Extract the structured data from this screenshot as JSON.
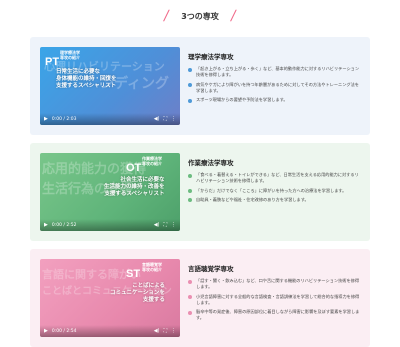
{
  "section": {
    "title": "3つの専攻",
    "accent_color": "#f06a8a"
  },
  "courses": [
    {
      "key": "pt",
      "abbr": "PT",
      "badge_sub": [
        "理学療法学",
        "専攻の紹介"
      ],
      "bg_text": [
        "心理リハビリテーション",
        "ンディング"
      ],
      "overlay_lines": [
        "日常生活に必要な",
        "身体機能の維持・回復を",
        "支援するスペシャリスト"
      ],
      "time": "0:00 / 2:03",
      "title": "理学療法学専攻",
      "bullets": [
        "「起き上がる・立ち上がる・歩く」など、基本的動作能力に対するリハビリテーション技術を修得します。",
        "病気やケガにより障がいを持つ年齢層があるために対してその方法やトレーニング法を学習します。",
        "スポーツ現場からの要望や予防法を学習します。"
      ]
    },
    {
      "key": "ot",
      "abbr": "OT",
      "badge_sub": [
        "作業療法学",
        "専攻の紹介"
      ],
      "bg_text": [
        "応用的能力の獲得",
        "生活行為の支援"
      ],
      "overlay_lines": [
        "社会生活に必要な",
        "生活能力の維持・改善を",
        "支援するスペシャリスト"
      ],
      "time": "0:00 / 2:52",
      "title": "作業療法学専攻",
      "bullets": [
        "「食べる・着替える・トイレができる」など、日常生活を支える応用的能力に対するリハビリテーション技術を修得します。",
        "「からだ」だけでなく「こころ」に障がいを持った方への治療法を学習します。",
        "自助具・義肢などや福祉・住宅改修のあり方を学習します。"
      ]
    },
    {
      "key": "st",
      "abbr": "ST",
      "badge_sub": [
        "言語聴覚学",
        "専攻の紹介"
      ],
      "bg_text": [
        "言語に関する障がい",
        "ことばとコミュニケーション"
      ],
      "overlay_lines": [
        "ことばによる",
        "コミュニケーションを",
        "支援する"
      ],
      "time": "0:00 / 2:54",
      "title": "言語聴覚学専攻",
      "bullets": [
        "「話す・聞く・飲み込む」など、口や舌に関する機能のリハビリテーション技術を修得します。",
        "小児言語障害に対する全般的な言語検査・言語訓練法を学習して総合的な指導力を修得します。",
        "脳卒中等の発症後、障害の原因部位に着目しながら障害に影響を及ぼす要素を学習します。"
      ]
    }
  ]
}
